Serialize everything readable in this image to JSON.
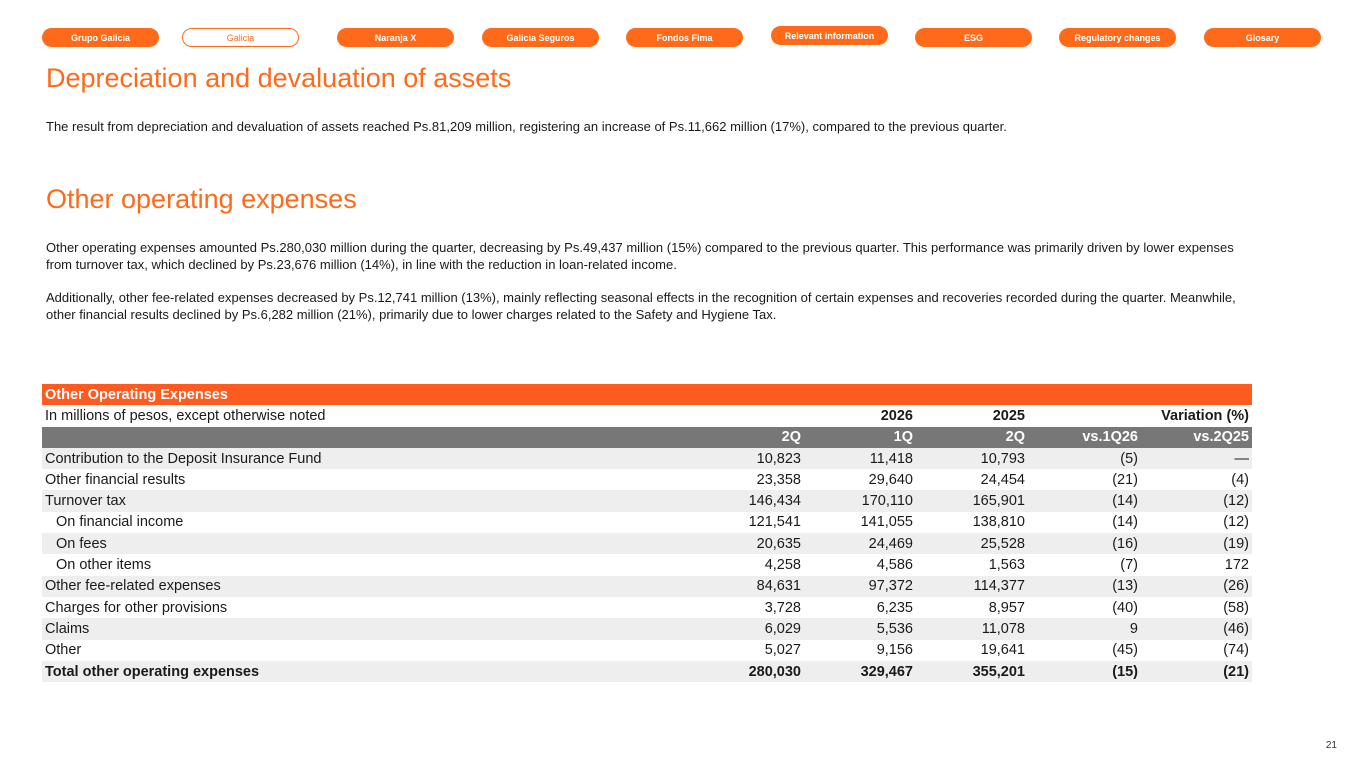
{
  "nav": {
    "tabs": [
      {
        "label": "Grupo Galicia"
      },
      {
        "label": "Galicia"
      },
      {
        "label": "Naranja X"
      },
      {
        "label": "Galicia Seguros"
      },
      {
        "label": "Fondos Fima"
      },
      {
        "label": "Relevant information"
      },
      {
        "label": "ESG"
      },
      {
        "label": "Regulatory changes"
      },
      {
        "label": "Glosary"
      }
    ],
    "active": "Galicia"
  },
  "section1": {
    "title": "Depreciation and devaluation of assets",
    "text": "The result from depreciation and devaluation of assets reached Ps.81,209 million, registering an increase of Ps.11,662 million (17%), compared to the previous quarter."
  },
  "section2": {
    "title": "Other operating expenses",
    "para1": "Other operating expenses amounted Ps.280,030 million during the quarter, decreasing by Ps.49,437 million (15%) compared to the previous quarter. This performance was primarily driven by lower expenses from turnover tax, which declined by Ps.23,676 million (14%), in line with the reduction in loan-related income.",
    "para2": "Additionally, other fee-related expenses decreased by Ps.12,741 million (13%), mainly reflecting seasonal effects in the recognition of certain expenses and recoveries recorded during the quarter. Meanwhile, other financial results declined by Ps.6,282 million (21%), primarily due to lower charges related to the Safety and Hygiene Tax."
  },
  "table": {
    "title": "Other Operating Expenses",
    "subtitle": "In millions of pesos, except otherwise noted",
    "years": [
      "2026",
      "2025"
    ],
    "variation_label": "Variation (%)",
    "periods": [
      "2Q",
      "1Q",
      "2Q",
      "vs.1Q26",
      "vs.2Q25"
    ],
    "rows": [
      {
        "label": "Contribution to the Deposit Insurance Fund",
        "values": [
          "10,823",
          "11,418",
          "10,793",
          "(5)",
          "—"
        ]
      },
      {
        "label": "Other financial results",
        "values": [
          "23,358",
          "29,640",
          "24,454",
          "(21)",
          "(4)"
        ]
      },
      {
        "label": "Turnover tax",
        "values": [
          "146,434",
          "170,110",
          "165,901",
          "(14)",
          "(12)"
        ]
      },
      {
        "label": "On financial income",
        "values": [
          "121,541",
          "141,055",
          "138,810",
          "(14)",
          "(12)"
        ]
      },
      {
        "label": "On fees",
        "values": [
          "20,635",
          "24,469",
          "25,528",
          "(16)",
          "(19)"
        ]
      },
      {
        "label": "On other items",
        "values": [
          "4,258",
          "4,586",
          "1,563",
          "(7)",
          "172"
        ]
      },
      {
        "label": "Other fee-related expenses",
        "values": [
          "84,631",
          "97,372",
          "114,377",
          "(13)",
          "(26)"
        ]
      },
      {
        "label": "Charges for other provisions",
        "values": [
          "3,728",
          "6,235",
          "8,957",
          "(40)",
          "(58)"
        ]
      },
      {
        "label": "Claims",
        "values": [
          "6,029",
          "5,536",
          "11,078",
          "9",
          "(46)"
        ]
      },
      {
        "label": "Other",
        "values": [
          "5,027",
          "9,156",
          "19,641",
          "(45)",
          "(74)"
        ]
      },
      {
        "label": "Total other operating expenses",
        "values": [
          "280,030",
          "329,467",
          "355,201",
          "(15)",
          "(21)"
        ]
      }
    ]
  },
  "page_number": "21",
  "colors": {
    "accent": "#ff6a1a",
    "table_header": "#ff5a1f",
    "period_bar": "#777777",
    "row_shade": "#eeeeee"
  }
}
